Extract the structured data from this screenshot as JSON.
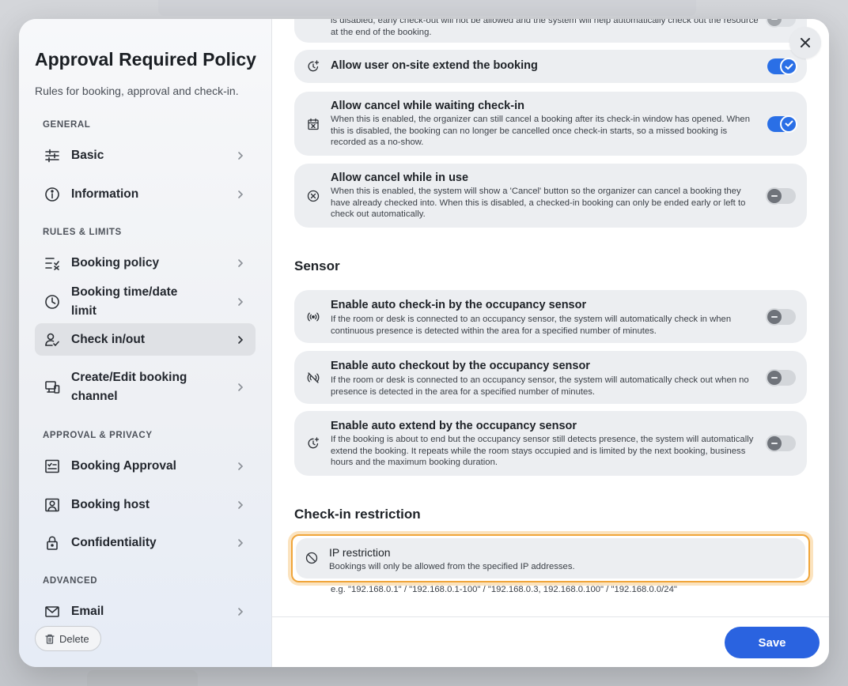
{
  "modal": {
    "title": "Approval Required Policy",
    "subtitle": "Rules for booking, approval and check-in."
  },
  "sidebar": {
    "sections": {
      "general": "GENERAL",
      "rules": "RULES & LIMITS",
      "approval": "APPROVAL & PRIVACY",
      "advanced": "ADVANCED"
    },
    "items": [
      {
        "label": "Basic",
        "icon": "sliders-icon"
      },
      {
        "label": "Information",
        "icon": "info-icon"
      },
      {
        "label": "Booking policy",
        "icon": "list-check-icon"
      },
      {
        "label": "Booking time/date limit",
        "icon": "clock-icon"
      },
      {
        "label": "Check in/out",
        "icon": "user-check-icon",
        "active": true
      },
      {
        "label": "Create/Edit booking channel",
        "icon": "devices-icon"
      },
      {
        "label": "Booking Approval",
        "icon": "approval-icon"
      },
      {
        "label": "Booking host",
        "icon": "host-icon"
      },
      {
        "label": "Confidentiality",
        "icon": "lock-icon"
      },
      {
        "label": "Email",
        "icon": "mail-icon"
      }
    ],
    "delete_label": "Delete"
  },
  "main": {
    "partial_top_desc": "is disabled, early check-out will not be allowed and the system will help automatically check out the resource at the end of the booking.",
    "cards": [
      {
        "title": "Allow user on-site extend the booking",
        "desc": "",
        "on": true
      },
      {
        "title": "Allow cancel while waiting check-in",
        "desc": "When this is enabled, the organizer can still cancel a booking after its check-in window has opened. When this is disabled, the booking can no longer be cancelled once check-in starts, so a missed booking is recorded as a no-show.",
        "on": true
      },
      {
        "title": "Allow cancel while in use",
        "desc": "When this is enabled, the system will show a 'Cancel' button so the organizer can cancel a booking they have already checked into. When this is disabled, a checked-in booking can only be ended early or left to check out automatically.",
        "on": false
      }
    ],
    "sensor_heading": "Sensor",
    "sensor_cards": [
      {
        "title": "Enable auto check-in by the occupancy sensor",
        "desc": "If the room or desk is connected to an occupancy sensor, the system will automatically check in when continuous presence is detected within the area for a specified number of minutes.",
        "on": false
      },
      {
        "title": "Enable auto checkout by the occupancy sensor",
        "desc": "If the room or desk is connected to an occupancy sensor, the system will automatically check out when no presence is detected in the area for a specified number of minutes.",
        "on": false
      },
      {
        "title": "Enable auto extend by the occupancy sensor",
        "desc": "If the booking is about to end but the occupancy sensor still detects presence, the system will automatically extend the booking. It repeats while the room stays occupied and is limited by the next booking, business hours and the maximum booking duration.",
        "on": false
      }
    ],
    "restriction_heading": "Check-in restriction",
    "ip": {
      "title": "IP restriction",
      "desc": "Bookings will only be allowed from the specified IP addresses.",
      "example": "e.g. \"192.168.0.1\" / \"192.168.0.1-100\" / \"192.168.0.3, 192.168.0.100\" / \"192.168.0.0/24\""
    }
  },
  "footer": {
    "save_label": "Save"
  },
  "colors": {
    "accent": "#2a63e0",
    "toggle_on": "#2a6fe6",
    "highlight": "#f0a53a"
  }
}
